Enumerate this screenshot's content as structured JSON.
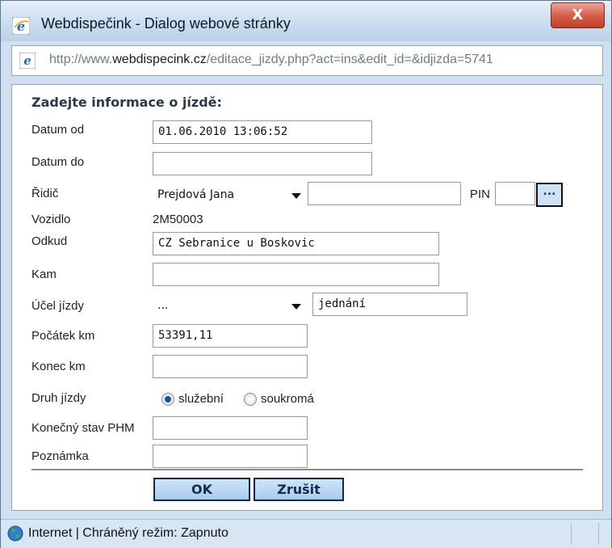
{
  "window": {
    "title": "Webdispečink - Dialog webové stránky",
    "close_label": "X"
  },
  "address": {
    "prefix": "http://www.",
    "domain": "webdispecink.cz",
    "path": "/editace_jizdy.php?act=ins&edit_id=&idjizda=5741"
  },
  "form": {
    "heading": "Zadejte informace o jízdě:",
    "datum_od": {
      "label": "Datum od",
      "value": "01.06.2010 13:06:52"
    },
    "datum_do": {
      "label": "Datum do",
      "value": ""
    },
    "ridic": {
      "label": "Řidič",
      "selected": "Prejdová Jana",
      "text": "",
      "pin_label": "PIN",
      "pin_value": "",
      "pick_label": "..."
    },
    "vozidlo": {
      "label": "Vozidlo",
      "value": "2M50003"
    },
    "odkud": {
      "label": "Odkud",
      "value": "CZ Sebranice u Boskovic"
    },
    "kam": {
      "label": "Kam",
      "value": ""
    },
    "ucel": {
      "label": "Účel jízdy",
      "selected": "...",
      "text": "jednání"
    },
    "pocatek_km": {
      "label": "Počátek km",
      "value": "53391,11"
    },
    "konec_km": {
      "label": "Konec km",
      "value": ""
    },
    "druh": {
      "label": "Druh jízdy",
      "option1": "služební",
      "option2": "soukromá",
      "selected": "služební"
    },
    "phm": {
      "label": "Konečný stav PHM",
      "value": ""
    },
    "poznamka": {
      "label": "Poznámka",
      "value": ""
    },
    "ok_label": "OK",
    "cancel_label": "Zrušit"
  },
  "status": {
    "text": "Internet | Chráněný režim: Zapnuto"
  },
  "colors": {
    "accent": "#1f4fa8",
    "button_bg": "#b6d6f1",
    "close": "#c9452c"
  }
}
